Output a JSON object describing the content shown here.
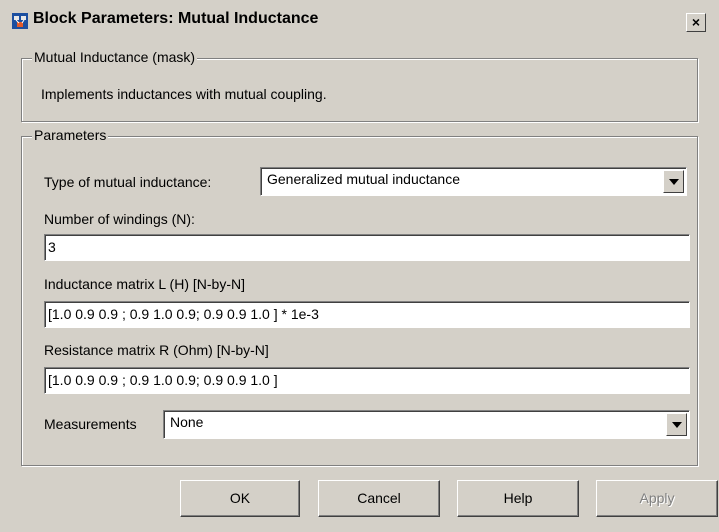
{
  "window": {
    "title": "Block Parameters: Mutual Inductance",
    "close_glyph": "×"
  },
  "mask": {
    "legend": "Mutual Inductance (mask)",
    "description": "Implements inductances with mutual coupling."
  },
  "parameters": {
    "legend": "Parameters",
    "type_label": "Type of mutual inductance:",
    "type_value": "Generalized mutual inductance",
    "windings_label": "Number of windings (N):",
    "windings_value": "3",
    "inductance_label": "Inductance matrix L (H) [N-by-N]",
    "inductance_value": "[1.0 0.9  0.9 ;  0.9 1.0  0.9;  0.9 0.9 1.0 ] * 1e-3",
    "resistance_label": "Resistance matrix R (Ohm) [N-by-N]",
    "resistance_value": "[1.0 0.9  0.9 ;  0.9 1.0  0.9;  0.9 0.9 1.0 ]",
    "measurements_label": "Measurements",
    "measurements_value": "None"
  },
  "buttons": {
    "ok": "OK",
    "cancel": "Cancel",
    "help": "Help",
    "apply": "Apply"
  },
  "colors": {
    "dialog_bg": "#d4d0c8",
    "field_bg": "#ffffff",
    "disabled_text": "#808080"
  }
}
